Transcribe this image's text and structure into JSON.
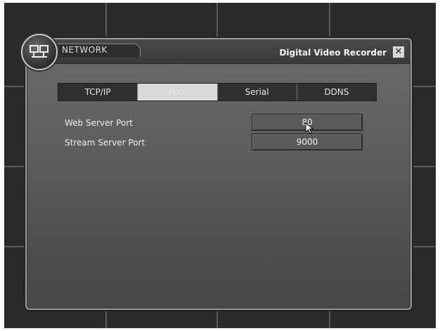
{
  "window": {
    "section_title": "NETWORK",
    "app_title": "Digital Video Recorder",
    "close_glyph": "✕"
  },
  "tabs": [
    {
      "label": "TCP/IP",
      "active": false
    },
    {
      "label": "Port",
      "active": true
    },
    {
      "label": "Serial",
      "active": false
    },
    {
      "label": "DDNS",
      "active": false
    }
  ],
  "fields": {
    "web_server_port": {
      "label": "Web Server Port",
      "value": "80"
    },
    "stream_server_port": {
      "label": "Stream Server Port",
      "value": "9000"
    }
  }
}
